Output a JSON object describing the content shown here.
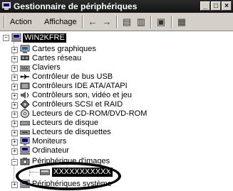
{
  "window": {
    "title": "Gestionnaire de périphériques",
    "buttons": [
      "_",
      "□",
      "×"
    ]
  },
  "menu": {
    "action": "Action",
    "affichage": "Affichage"
  },
  "tree": {
    "root": "WIN2KFRE",
    "items": [
      {
        "label": "Cartes graphiques",
        "icon": "display-adapter-icon"
      },
      {
        "label": "Cartes réseau",
        "icon": "network-adapter-icon"
      },
      {
        "label": "Claviers",
        "icon": "keyboard-icon"
      },
      {
        "label": "Contrôleur de bus USB",
        "icon": "usb-icon"
      },
      {
        "label": "Contrôleurs IDE ATA/ATAPI",
        "icon": "ide-controller-icon"
      },
      {
        "label": "Contrôleurs son, vidéo et jeu",
        "icon": "sound-icon"
      },
      {
        "label": "Contrôleurs SCSI et RAID",
        "icon": "scsi-icon"
      },
      {
        "label": "Lecteurs de CD-ROM/DVD-ROM",
        "icon": "cdrom-icon"
      },
      {
        "label": "Lecteurs de disque",
        "icon": "disk-drive-icon"
      },
      {
        "label": "Lecteurs de disquettes",
        "icon": "floppy-icon"
      },
      {
        "label": "Moniteurs",
        "icon": "monitor-icon"
      },
      {
        "label": "Ordinateur",
        "icon": "computer-icon"
      },
      {
        "label": "Périphérique d'images",
        "icon": "imaging-device-icon"
      },
      {
        "label": "XXXXXXXXXXX",
        "icon": "scanner-icon"
      },
      {
        "label": "Périphériques système",
        "icon": "system-devices-icon"
      }
    ]
  }
}
